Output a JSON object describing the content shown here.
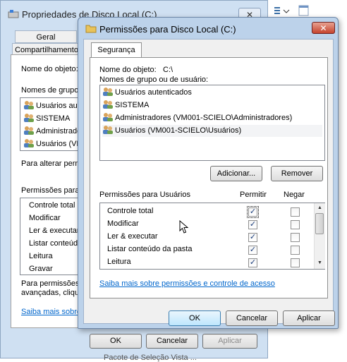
{
  "background_dialog": {
    "title": "Propriedades de Disco Local (C:)",
    "close_label": "✕",
    "tabs": [
      "Geral",
      "Compartilhamento"
    ],
    "object_name_label": "Nome do objeto:",
    "groups_label": "Nomes de grupo o",
    "users": [
      "Usuários aut",
      "SISTEMA",
      "Administrado",
      "Usuários (VM"
    ],
    "change_perms_text": "Para alterar permi",
    "perms_label": "Permissões para",
    "perms": [
      "Controle total",
      "Modificar",
      "Ler & executar",
      "Listar conteúd",
      "Leitura",
      "Gravar"
    ],
    "advanced_text_1": "Para permissões e",
    "advanced_text_2": "avançadas, cliqu",
    "link": "Saiba mais sobre",
    "ok": "OK",
    "cancel": "Cancelar",
    "apply": "Aplicar",
    "bottom_cut": "Pacote de Seleção Vista ..."
  },
  "dialog": {
    "title": "Permissões para Disco Local (C:)",
    "close_label": "✕",
    "tab": "Segurança",
    "object_name_label": "Nome do objeto:",
    "object_name_value": "C:\\",
    "groups_label": "Nomes de grupo ou de usuário:",
    "users": [
      "Usuários autenticados",
      "SISTEMA",
      "Administradores (VM001-SCIELO\\Administradores)",
      "Usuários (VM001-SCIELO\\Usuários)"
    ],
    "add_button": "Adicionar...",
    "remove_button": "Remover",
    "perms_label": "Permissões para Usuários",
    "allow_header": "Permitir",
    "deny_header": "Negar",
    "permissions": [
      {
        "name": "Controle total",
        "allow": true,
        "deny": false
      },
      {
        "name": "Modificar",
        "allow": true,
        "deny": false
      },
      {
        "name": "Ler & executar",
        "allow": true,
        "deny": false
      },
      {
        "name": "Listar conteúdo da pasta",
        "allow": true,
        "deny": false
      },
      {
        "name": "Leitura",
        "allow": true,
        "deny": false
      }
    ],
    "link": "Saiba mais sobre permissões e controle de acesso",
    "ok": "OK",
    "cancel": "Cancelar",
    "apply": "Aplicar"
  },
  "colors": {
    "title_bg": "#bcd2ea",
    "close_red": "#c5432d",
    "link": "#0066cc"
  }
}
